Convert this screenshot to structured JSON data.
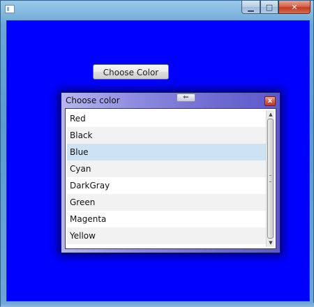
{
  "window": {
    "icon": "window-app-icon",
    "caption_buttons": {
      "minimize_glyph": "▁",
      "maximize_glyph": "□",
      "close_glyph": "✕"
    },
    "client_background": "#0000ff"
  },
  "main": {
    "choose_button_label": "Choose Color"
  },
  "dialog": {
    "title": "Choose color",
    "close_glyph": "x",
    "grip_glyph": "⇐",
    "items": [
      {
        "label": "Red",
        "selected": false
      },
      {
        "label": "Black",
        "selected": false
      },
      {
        "label": "Blue",
        "selected": true
      },
      {
        "label": "Cyan",
        "selected": false
      },
      {
        "label": "DarkGray",
        "selected": false
      },
      {
        "label": "Green",
        "selected": false
      },
      {
        "label": "Magenta",
        "selected": false
      },
      {
        "label": "Yellow",
        "selected": false
      }
    ],
    "selection_color": "#cde3f3",
    "scroll_up_glyph": "▲",
    "scroll_down_glyph": "▼"
  }
}
